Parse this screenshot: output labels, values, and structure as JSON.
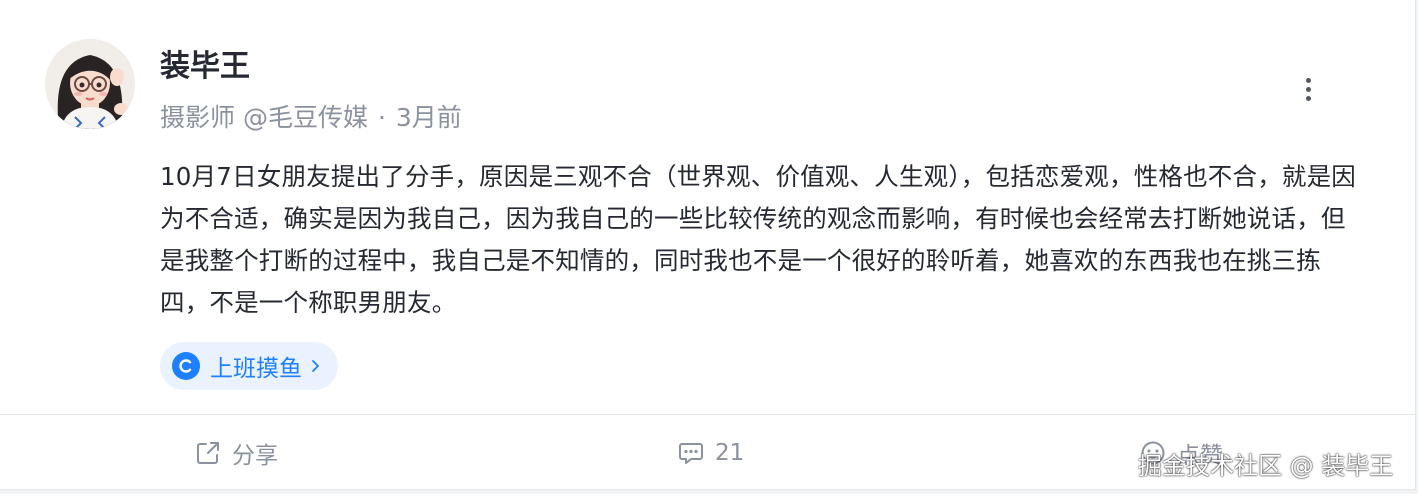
{
  "post": {
    "author": {
      "name": "装毕王",
      "title": "摄影师 @毛豆传媒",
      "time": "3月前"
    },
    "meta_separator": "·",
    "content": "10月7日女朋友提出了分手，原因是三观不合（世界观、价值观、人生观），包括恋爱观，性格也不合，就是因为不合适，确实是因为我自己，因为我自己的一些比较传统的观念而影响，有时候也会经常去打断她说话，但是我整个打断的过程中，我自己是不知情的，同时我也不是一个很好的聆听着，她喜欢的东西我也在挑三拣四，不是一个称职男朋友。",
    "topic": {
      "label": "上班摸鱼",
      "icon": "topic-c-icon",
      "color": "#1e80ff",
      "background": "#eaf2ff"
    }
  },
  "actions": {
    "share": {
      "label": "分享",
      "icon": "share-icon"
    },
    "comment": {
      "count": "21",
      "icon": "comment-icon"
    },
    "like": {
      "label": "点赞",
      "icon": "like-icon"
    }
  },
  "watermark": "掘金技术社区 @ 装毕王",
  "colors": {
    "text_primary": "#252933",
    "text_secondary": "#8a919f",
    "accent": "#1e80ff",
    "divider": "#e4e6eb"
  }
}
